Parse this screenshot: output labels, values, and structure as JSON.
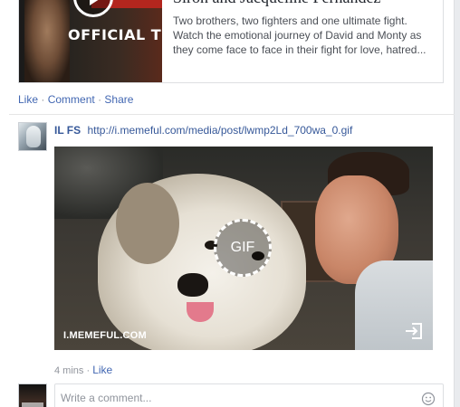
{
  "link_preview": {
    "thumbnail_text": "OFFICIAL TRA",
    "title": "Siron and Jacqueline Fernandez",
    "description": "Two brothers, two fighters and one ultimate fight. Watch the emotional journey of David and Monty as they come face to face in their fight for love, hatred..."
  },
  "post_actions": {
    "like": "Like",
    "comment": "Comment",
    "share": "Share",
    "separator": "·"
  },
  "comment": {
    "author": "IL FS",
    "url": "http://i.memeful.com/media/post/lwmp2Ld_700wa_0.gif",
    "gif_badge": "GIF",
    "watermark": "I.MEMEFUL.COM",
    "time": "4 mins",
    "separator": "·",
    "like": "Like"
  },
  "composer": {
    "placeholder": "Write a comment..."
  },
  "colors": {
    "link": "#365899",
    "action": "#4267b2",
    "muted": "#90949c"
  },
  "icons": {
    "play": "play-icon",
    "open_external": "open-external-icon",
    "emoji": "emoji-icon"
  }
}
